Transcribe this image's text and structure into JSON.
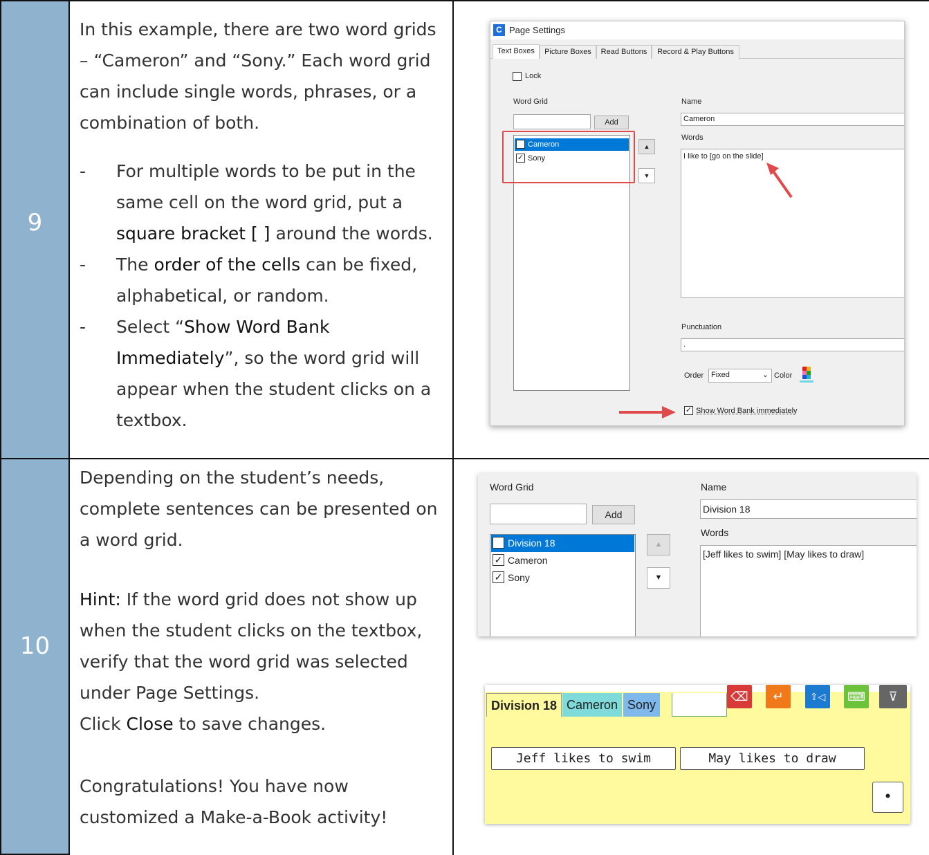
{
  "steps": [
    {
      "number": "9",
      "paragraphs": [
        "In this example, there are two word grids – “Cameron” and “Sony.” Each word grid can include single words, phrases, or a combination of both."
      ],
      "bullets": [
        {
          "dash": "-",
          "pre": "For multiple words to be put in the same cell on the word grid, put a ",
          "em": "square bracket [ ]",
          "post": " around the words."
        },
        {
          "dash": "-",
          "pre": "The ",
          "em": "order of the cells",
          "post": " can be fixed, alphabetical, or random."
        },
        {
          "dash": "-",
          "pre": "Select “",
          "em": "Show Word Bank Immediately",
          "post": "”, so the word grid will appear when the student clicks on a textbox."
        }
      ]
    },
    {
      "number": "10",
      "p1": "Depending on the student’s needs, complete sentences can be presented on a word grid.",
      "hint_label": "Hint:",
      "hint_text": " If the word grid does not show up when the student clicks on the textbox, verify that the word grid was selected under Page Settings.",
      "close_pre": "Click ",
      "close_em": "Close",
      "close_post": " to save changes.",
      "congrats": "Congratulations! You have now customized a Make-a-Book activity!"
    }
  ],
  "page_settings": {
    "title": "Page Settings",
    "icon_letter": "C",
    "tabs": [
      "Text Boxes",
      "Picture Boxes",
      "Read Buttons",
      "Record & Play Buttons"
    ],
    "lock_label": "Lock",
    "word_grid_label": "Word Grid",
    "add_label": "Add",
    "grid_items": [
      "Cameron",
      "Sony"
    ],
    "name_label": "Name",
    "name_value": "Cameron",
    "words_label": "Words",
    "words_value": "I like to [go on the slide]",
    "punctuation_label": "Punctuation",
    "punctuation_value": ".",
    "order_label": "Order",
    "order_value": "Fixed",
    "color_label": "Color",
    "show_word_bank_label": "Show Word Bank immediately",
    "accent_color": "#e04a4a"
  },
  "page_settings_2": {
    "word_grid_label": "Word Grid",
    "add_label": "Add",
    "grid_items": [
      "Division 18",
      "Cameron",
      "Sony"
    ],
    "name_label": "Name",
    "name_value": "Division 18",
    "words_label": "Words",
    "words_value": "[Jeff likes to swim] [May likes to draw]"
  },
  "word_bank": {
    "tabs": [
      "Division 18",
      "Cameron",
      "Sony"
    ],
    "cells": [
      "Jeff likes to swim",
      "May likes to draw"
    ],
    "punctuation": "•",
    "button_icons": [
      "backspace-icon",
      "enter-icon",
      "speak-icon",
      "keyboard-icon",
      "collapse-icon"
    ],
    "button_colors": [
      "#d83a3a",
      "#f07a1a",
      "#1c7ad0",
      "#6cc23a",
      "#555555"
    ]
  }
}
